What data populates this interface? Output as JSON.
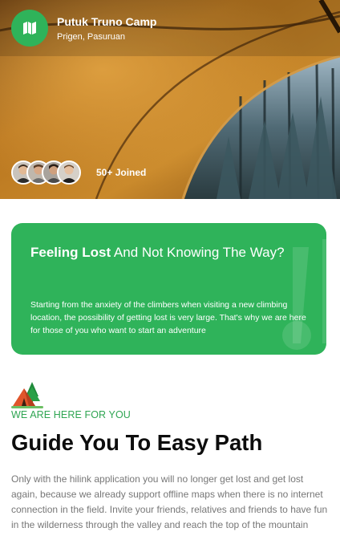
{
  "hero": {
    "app_name": "Putuk Truno Camp",
    "location": "Prigen, Pasuruan",
    "logo_icon": "map-icon",
    "joined_label": "50+ Joined",
    "avatar_count": 4
  },
  "card": {
    "title_bold": "Feeling Lost",
    "title_rest": " And Not Knowing The Way?",
    "body": "Starting from the anxiety of the climbers when visiting a new climbing location, the possibility of getting lost is very large. That's why we are here for those of you who want to start an adventure"
  },
  "section": {
    "icon": "camping-tent-icon",
    "eyebrow": "WE ARE HERE FOR YOU",
    "heading": "Guide You To Easy Path",
    "paragraph": "Only with the hilink application you will no longer get lost and get lost again, because we already support offline maps when there is no internet connection in the field. Invite your friends, relatives and friends to have fun in the wilderness through the valley and reach the top of the mountain"
  },
  "colors": {
    "accent": "#2fb35a",
    "eyebrow": "#2fa552",
    "heading": "#0d0d0d",
    "body_text": "#777777"
  }
}
